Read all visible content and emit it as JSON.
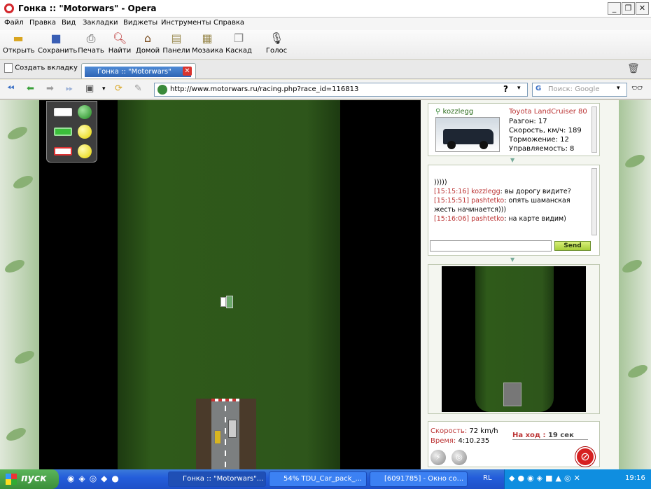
{
  "window": {
    "title": "Гонка :: \"Motorwars\" - Opera"
  },
  "menu": [
    "Файл",
    "Правка",
    "Вид",
    "Закладки",
    "Виджеты",
    "Инструменты",
    "Справка"
  ],
  "toolbar": [
    "Открыть",
    "Сохранить",
    "Печать",
    "Найти",
    "Домой",
    "Панели",
    "Мозаика",
    "Каскад",
    "Голос"
  ],
  "tabs": {
    "new_tab": "Создать вкладку",
    "active": "Гонка :: \"Motorwars\""
  },
  "address": {
    "url": "http://www.motorwars.ru/racing.php?race_id=116813",
    "search_placeholder": "Поиск: Google"
  },
  "car": {
    "user": "kozzlegg",
    "model": "Toyota LandCruiser 80",
    "accel": "Разгон: 17",
    "speed": "Скорость, км/ч: 189",
    "brake": "Торможение: 12",
    "handling": "Управляемость: 8"
  },
  "chat": [
    {
      "time": "",
      "user": "",
      "text": ")))))"
    },
    {
      "time": "[15:15:16]",
      "user": "kozzlegg",
      "text": "вы дорогу видите?"
    },
    {
      "time": "[15:15:51]",
      "user": "pashtetko",
      "text": "опять шаманская жесть начинается)))"
    },
    {
      "time": "[15:16:06]",
      "user": "pashtetko",
      "text": "на карте видим)"
    }
  ],
  "chat_send": "Send",
  "status": {
    "speed_label": "Скорость:",
    "speed_value": "72 km/h",
    "time_label": "Время:",
    "time_value": "4:10.235",
    "turn_label": "На ход :",
    "turn_value": "19 сек"
  },
  "taskbar": {
    "start": "пуск",
    "tasks": [
      "Гонка :: \"Motorwars\"...",
      "54% TDU_Car_pack_...",
      "[6091785] - Окно со..."
    ],
    "lang": "RL",
    "clock": "19:16"
  },
  "colors": {
    "grass": "#2e561b",
    "accent_red": "#b33333",
    "taskbar": "#245edb"
  }
}
